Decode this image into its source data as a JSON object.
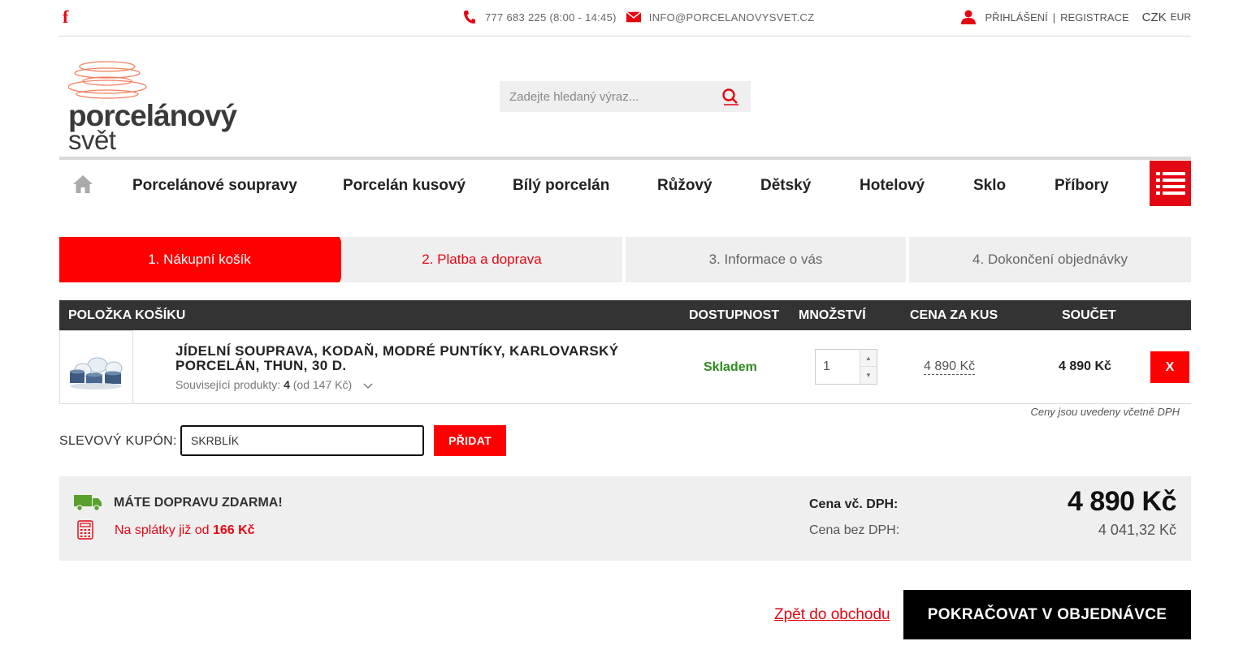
{
  "topbar": {
    "facebook": "f",
    "phone": "777 683 225 (8:00 - 14:45)",
    "email": "INFO@PORCELANOVYSVET.CZ",
    "login": "PŘIHLÁŠENÍ",
    "separator": "|",
    "register": "REGISTRACE",
    "currency_active": "CZK",
    "currency_other": "EUR"
  },
  "logo": {
    "line1": "porcelánový",
    "line2": "svět"
  },
  "search": {
    "placeholder": "Zadejte hledaný výraz..."
  },
  "nav": {
    "items": [
      "Porcelánové soupravy",
      "Porcelán kusový",
      "Bílý porcelán",
      "Růžový",
      "Dětský",
      "Hotelový",
      "Sklo",
      "Příbory"
    ]
  },
  "steps": [
    "1. Nákupní košík",
    "2. Platba a doprava",
    "3. Informace o vás",
    "4. Dokončení objednávky"
  ],
  "table": {
    "headers": {
      "item": "POLOŽKA KOŠÍKU",
      "availability": "DOSTUPNOST",
      "quantity": "MNOŽSTVÍ",
      "unit_price": "CENA ZA KUS",
      "total": "SOUČET"
    },
    "row": {
      "name": "JÍDELNÍ SOUPRAVA, KODAŇ, MODRÉ PUNTÍKY, KARLOVARSKÝ PORCELÁN, THUN, 30 D.",
      "related_label": "Související produkty:",
      "related_count": "4",
      "related_price": "(od 147 Kč)",
      "availability": "Skladem",
      "quantity": "1",
      "unit_price": "4 890 Kč",
      "total": "4 890 Kč",
      "remove": "X"
    },
    "vat_note": "Ceny jsou uvedeny včetně DPH"
  },
  "coupon": {
    "label": "SLEVOVÝ KUPÓN:",
    "value": "SKRBLÍK",
    "button": "PŘIDAT"
  },
  "summary": {
    "free_shipping": "MÁTE DOPRAVU ZDARMA!",
    "installment_text": "Na splátky již od",
    "installment_amount": "166 Kč",
    "price_vat_label": "Cena vč. DPH:",
    "price_vat_value": "4 890 Kč",
    "price_novat_label": "Cena bez DPH:",
    "price_novat_value": "4 041,32 Kč"
  },
  "actions": {
    "back": "Zpět do obchodu",
    "continue": "POKRAČOVAT V OBJEDNÁVCE"
  },
  "colors": {
    "accent": "#ff0000",
    "dark": "#333333",
    "available": "#2e8b1e",
    "panel": "#efefef"
  }
}
